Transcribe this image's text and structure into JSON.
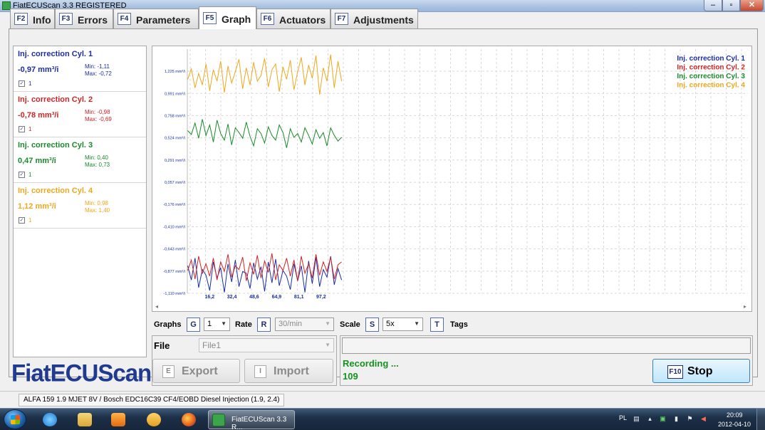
{
  "window": {
    "title": "FiatECUScan 3.3 REGISTERED"
  },
  "tabs": [
    {
      "key": "F2",
      "label": "Info"
    },
    {
      "key": "F3",
      "label": "Errors"
    },
    {
      "key": "F4",
      "label": "Parameters"
    },
    {
      "key": "F5",
      "label": "Graph",
      "active": true
    },
    {
      "key": "F6",
      "label": "Actuators"
    },
    {
      "key": "F7",
      "label": "Adjustments"
    }
  ],
  "params": [
    {
      "name": "Inj. correction Cyl. 1",
      "value": "-0,97 mm³/i",
      "min": "Min: -1,11",
      "max": "Max: -0,72",
      "checkbox_label": "1",
      "color": "#1a2ea8"
    },
    {
      "name": "Inj. correction Cyl. 2",
      "value": "-0,78 mm³/i",
      "min": "Min: -0,98",
      "max": "Max: -0,69",
      "checkbox_label": "1",
      "color": "#d42323"
    },
    {
      "name": "Inj. correction Cyl. 3",
      "value": "0,47 mm³/i",
      "min": "Min: 0,40",
      "max": "Max: 0,73",
      "checkbox_label": "1",
      "color": "#1a8a2a"
    },
    {
      "name": "Inj. correction Cyl. 4",
      "value": "1,12 mm³/i",
      "min": "Min: 0,98",
      "max": "Max: 1,40",
      "checkbox_label": "1",
      "color": "#f0a71c"
    }
  ],
  "logo": "FiatECUScan",
  "controls": {
    "graphs_label": "Graphs",
    "graphs_key": "G",
    "graphs_value": "1",
    "rate_label": "Rate",
    "rate_key": "R",
    "rate_value": "30/min",
    "scale_label": "Scale",
    "scale_key": "S",
    "scale_value": "5x",
    "tags_key": "T",
    "tags_label": "Tags"
  },
  "file": {
    "label": "File",
    "value": "File1",
    "export_key": "E",
    "export_label": "Export",
    "import_key": "I",
    "import_label": "Import"
  },
  "status": {
    "text": "Recording ...",
    "count": "109",
    "stop_key": "F10",
    "stop_label": "Stop"
  },
  "vehicle_info": "ALFA 159 1.9 MJET 8V / Bosch EDC16C39 CF4/EOBD Diesel Injection (1.9, 2.4)",
  "taskbar": {
    "app_label": "FiatECUScan 3.3 R...",
    "lang": "PL",
    "time": "20:09",
    "date": "2012-04-10"
  },
  "chart_data": {
    "type": "line",
    "y_tick_labels": [
      "1,225 mm³/i",
      "0,991 mm³/i",
      "0,758 mm³/i",
      "0,524 mm³/i",
      "0,291 mm³/i",
      "0,057 mm³/i",
      "-0,176 mm³/i",
      "-0,410 mm³/i",
      "-0,643 mm³/i",
      "-0,877 mm³/i",
      "-1,110 mm³/i"
    ],
    "y_ticks": [
      1.225,
      0.991,
      0.758,
      0.524,
      0.291,
      0.057,
      -0.176,
      -0.41,
      -0.643,
      -0.877,
      -1.11
    ],
    "x_tick_labels": [
      "16,2",
      "32,4",
      "48,6",
      "64,9",
      "81,1",
      "97,2"
    ],
    "x_ticks": [
      16.2,
      32.4,
      48.6,
      64.9,
      81.1,
      97.2
    ],
    "grid": true,
    "legend_placement": "top-right",
    "series": [
      {
        "name": "Inj. correction Cyl. 1",
        "color": "#1a2ea8",
        "values": [
          -0.82,
          -0.97,
          -0.74,
          -1.05,
          -0.86,
          -0.92,
          -1.08,
          -0.78,
          -0.95,
          -0.84,
          -1.1,
          -0.8,
          -0.99,
          -0.76,
          -1.04,
          -0.88,
          -0.9,
          -1.06,
          -0.79,
          -0.96,
          -0.83,
          -1.09,
          -0.78,
          -1.0,
          -0.75,
          -1.03,
          -0.87,
          -0.93,
          -1.07,
          -0.8,
          -0.98,
          -0.82,
          -1.1,
          -0.77,
          -1.01,
          -0.73,
          -1.04,
          -0.86,
          -0.94,
          -0.72,
          -1.02,
          -0.85,
          -0.97
        ]
      },
      {
        "name": "Inj. correction Cyl. 2",
        "color": "#d42323",
        "values": [
          -0.87,
          -0.76,
          -0.96,
          -0.72,
          -0.9,
          -0.8,
          -0.93,
          -0.74,
          -0.97,
          -0.78,
          -0.88,
          -0.7,
          -0.94,
          -0.82,
          -0.86,
          -0.73,
          -0.98,
          -0.79,
          -0.91,
          -0.71,
          -0.95,
          -0.77,
          -0.89,
          -0.69,
          -0.97,
          -0.81,
          -0.87,
          -0.74,
          -0.93,
          -0.76,
          -0.98,
          -0.72,
          -0.9,
          -0.8,
          -0.95,
          -0.7,
          -0.92,
          -0.78,
          -0.88,
          -0.73,
          -0.96,
          -0.81,
          -0.78
        ]
      },
      {
        "name": "Inj. correction Cyl. 3",
        "color": "#1a8a2a",
        "values": [
          0.6,
          0.56,
          0.68,
          0.52,
          0.72,
          0.55,
          0.66,
          0.48,
          0.71,
          0.57,
          0.5,
          0.67,
          0.45,
          0.63,
          0.58,
          0.52,
          0.69,
          0.54,
          0.44,
          0.62,
          0.57,
          0.47,
          0.64,
          0.55,
          0.5,
          0.66,
          0.58,
          0.42,
          0.62,
          0.53,
          0.57,
          0.48,
          0.63,
          0.55,
          0.46,
          0.61,
          0.52,
          0.58,
          0.44,
          0.63,
          0.55,
          0.49,
          0.53
        ]
      },
      {
        "name": "Inj. correction Cyl. 4",
        "color": "#f0a71c",
        "values": [
          1.14,
          1.25,
          1.05,
          1.2,
          1.08,
          1.3,
          1.02,
          1.24,
          1.12,
          1.33,
          1.0,
          1.28,
          1.1,
          1.22,
          1.35,
          1.04,
          1.26,
          1.08,
          1.32,
          1.12,
          1.18,
          1.36,
          1.06,
          1.24,
          1.3,
          1.01,
          1.27,
          1.14,
          1.34,
          1.03,
          1.22,
          1.37,
          1.08,
          1.29,
          1.15,
          1.39,
          0.98,
          1.26,
          1.12,
          1.4,
          1.05,
          1.33,
          1.12
        ]
      }
    ]
  }
}
